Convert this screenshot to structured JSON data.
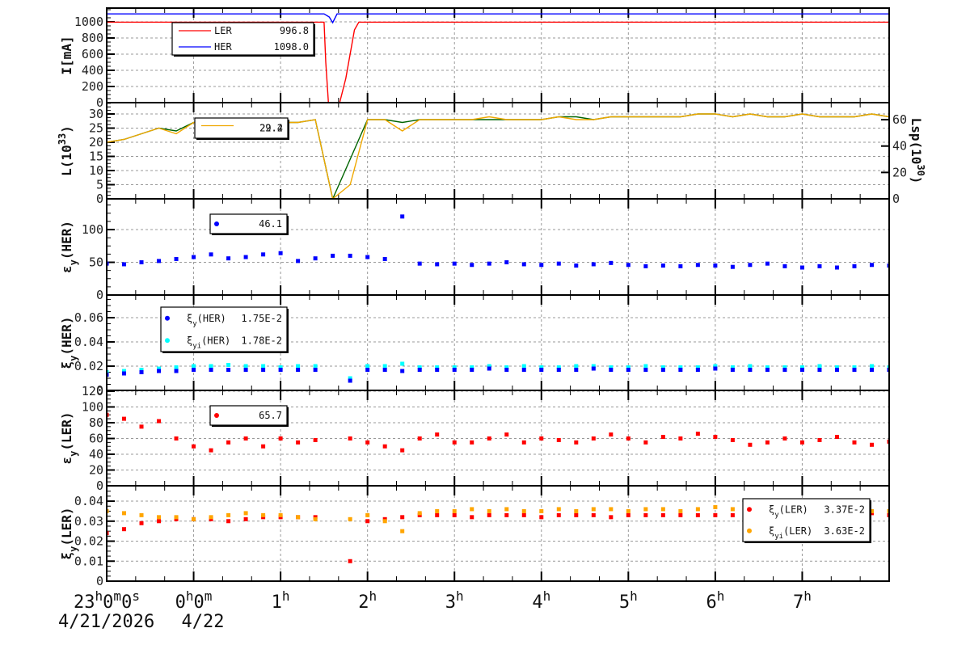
{
  "chart_data": {
    "type": "multi-panel time series",
    "x_axis": {
      "unit": "hours since 23:00 4/21/2026",
      "range": [
        0,
        9
      ],
      "tick_labels": [
        {
          "t": 0,
          "parts": [
            {
              "t": "23"
            },
            {
              "t": "h",
              "sup": true
            },
            {
              "t": "0"
            },
            {
              "t": "m",
              "sup": true
            },
            {
              "t": "0"
            },
            {
              "t": "s",
              "sup": true
            }
          ],
          "date": "4/21/2026"
        },
        {
          "t": 1,
          "parts": [
            {
              "t": "0"
            },
            {
              "t": "h",
              "sup": true
            },
            {
              "t": "0"
            },
            {
              "t": "m",
              "sup": true
            }
          ],
          "date": "4/22"
        },
        {
          "t": 2,
          "parts": [
            {
              "t": "1"
            },
            {
              "t": "h",
              "sup": true
            }
          ]
        },
        {
          "t": 3,
          "parts": [
            {
              "t": "2"
            },
            {
              "t": "h",
              "sup": true
            }
          ]
        },
        {
          "t": 4,
          "parts": [
            {
              "t": "3"
            },
            {
              "t": "h",
              "sup": true
            }
          ]
        },
        {
          "t": 5,
          "parts": [
            {
              "t": "4"
            },
            {
              "t": "h",
              "sup": true
            }
          ]
        },
        {
          "t": 6,
          "parts": [
            {
              "t": "5"
            },
            {
              "t": "h",
              "sup": true
            }
          ]
        },
        {
          "t": 7,
          "parts": [
            {
              "t": "6"
            },
            {
              "t": "h",
              "sup": true
            }
          ]
        },
        {
          "t": 8,
          "parts": [
            {
              "t": "7"
            },
            {
              "t": "h",
              "sup": true
            }
          ]
        }
      ]
    },
    "panels": [
      {
        "id": "current",
        "ylabel": [
          {
            "t": "I[mA]"
          }
        ],
        "ylim": [
          0,
          1170
        ],
        "yticks": [
          0,
          200,
          400,
          600,
          800,
          1000
        ],
        "series": [
          {
            "name": "LER",
            "kind": "line",
            "color": "#ff0000",
            "t": [
              0,
              2.5,
              2.52,
              2.55,
              2.68,
              2.75,
              2.85,
              2.9,
              9
            ],
            "values": [
              996,
              996,
              500,
              0,
              0,
              300,
              900,
              996,
              996
            ]
          },
          {
            "name": "HER",
            "kind": "line",
            "color": "#0000ff",
            "t": [
              0,
              2.5,
              2.56,
              2.6,
              2.65,
              9
            ],
            "values": [
              1098,
              1098,
              1060,
              990,
              1098,
              1098
            ]
          }
        ],
        "legend": [
          {
            "marker": "line",
            "color": "#ff0000",
            "label": "LER",
            "value": "996.8"
          },
          {
            "marker": "line",
            "color": "#0000ff",
            "label": "HER",
            "value": "1098.0"
          }
        ]
      },
      {
        "id": "luminosity",
        "ylabel": [
          {
            "t": "L(10"
          },
          {
            "t": "33",
            "sup": true
          },
          {
            "t": ")"
          }
        ],
        "ylim": [
          0,
          34
        ],
        "yticks": [
          0,
          5,
          10,
          15,
          20,
          25,
          30
        ],
        "y2label": [
          {
            "t": "Lsp(10"
          },
          {
            "t": "30",
            "sup": true
          },
          {
            "t": ")"
          }
        ],
        "y2lim": [
          0,
          72.9
        ],
        "y2ticks": [
          0,
          20,
          40,
          60
        ],
        "series": [
          {
            "name": "L HER",
            "kind": "line",
            "color": "#006400",
            "t_start": 0,
            "t_step": 0.2,
            "values": [
              20,
              21,
              23,
              25,
              24,
              27,
              27,
              27,
              27,
              26,
              27,
              27,
              28,
              0,
              14,
              28,
              28,
              27,
              28,
              28,
              28,
              28,
              28,
              28,
              28,
              28,
              29,
              29,
              28,
              29,
              29,
              29,
              29,
              29,
              30,
              30,
              29,
              30,
              29,
              29,
              30,
              29,
              29,
              29,
              30,
              29
            ]
          },
          {
            "name": "L LER",
            "kind": "line",
            "color": "#f0a800",
            "t_start": 0,
            "t_step": 0.2,
            "values": [
              20,
              21,
              23,
              25,
              23,
              27,
              26,
              27,
              27,
              25,
              27,
              27,
              28,
              0,
              5,
              28,
              28,
              24,
              28,
              28,
              28,
              28,
              29,
              28,
              28,
              28,
              29,
              28,
              28,
              29,
              29,
              29,
              29,
              29,
              30,
              30,
              29,
              30,
              29,
              29,
              30,
              29,
              29,
              29,
              30,
              29
            ]
          }
        ],
        "legend": [
          {
            "marker": "line",
            "color": "#f0a800",
            "label": "",
            "value": "29.4"
          },
          {
            "marker": "none",
            "color": "#006400",
            "label": "",
            "value": "22.2"
          }
        ]
      },
      {
        "id": "emittance-her",
        "ylabel": [
          {
            "t": "ε"
          },
          {
            "t": "y",
            "sub": true
          },
          {
            "t": "(HER)"
          }
        ],
        "ylim": [
          0,
          147
        ],
        "yticks": [
          0,
          50,
          100
        ],
        "series": [
          {
            "name": "εy(HER)",
            "kind": "scatter",
            "color": "#0000ff",
            "t_start": 0,
            "t_step": 0.2,
            "values": [
              48,
              47,
              50,
              52,
              55,
              58,
              62,
              56,
              58,
              62,
              64,
              52,
              56,
              60,
              60,
              58,
              55,
              120,
              48,
              47,
              48,
              46,
              48,
              50,
              47,
              46,
              48,
              45,
              47,
              49,
              46,
              44,
              45,
              44,
              46,
              45,
              43,
              46,
              48,
              44,
              42,
              44,
              42,
              44,
              46,
              45
            ]
          }
        ],
        "legend": [
          {
            "marker": "dot",
            "color": "#0000ff",
            "label": "",
            "value": "46.1"
          }
        ]
      },
      {
        "id": "xi-her",
        "ylabel": [
          {
            "t": "ξ"
          },
          {
            "t": "y",
            "sub": true
          },
          {
            "t": "(HER)"
          }
        ],
        "ylim": [
          0,
          0.0787
        ],
        "yticks": [
          0,
          0.02,
          0.04,
          0.06
        ],
        "ytick_labels": [
          "0",
          "0.02",
          "0.04",
          "0.06"
        ],
        "series": [
          {
            "name": "ξyi(HER)",
            "kind": "scatter",
            "color": "#00ffff",
            "t_start": 0,
            "t_step": 0.2,
            "values": [
              0.015,
              0.016,
              0.017,
              0.018,
              0.019,
              0.02,
              0.02,
              0.021,
              0.02,
              0.02,
              0.019,
              0.02,
              0.02,
              null,
              0.01,
              0.02,
              0.02,
              0.022,
              0.019,
              0.019,
              0.019,
              0.019,
              0.02,
              0.019,
              0.02,
              0.019,
              0.019,
              0.02,
              0.02,
              0.019,
              0.019,
              0.02,
              0.019,
              0.019,
              0.019,
              0.02,
              0.019,
              0.02,
              0.019,
              0.019,
              0.019,
              0.02,
              0.019,
              0.019,
              0.02,
              0.019
            ]
          },
          {
            "name": "ξy(HER)",
            "kind": "scatter",
            "color": "#0000ff",
            "t_start": 0,
            "t_step": 0.2,
            "values": [
              0.013,
              0.014,
              0.015,
              0.016,
              0.016,
              0.017,
              0.017,
              0.017,
              0.017,
              0.017,
              0.017,
              0.017,
              0.017,
              null,
              0.008,
              0.017,
              0.017,
              0.016,
              0.017,
              0.017,
              0.017,
              0.017,
              0.018,
              0.017,
              0.017,
              0.017,
              0.017,
              0.017,
              0.018,
              0.017,
              0.017,
              0.017,
              0.017,
              0.017,
              0.017,
              0.018,
              0.017,
              0.017,
              0.017,
              0.017,
              0.017,
              0.017,
              0.017,
              0.017,
              0.017,
              0.017
            ]
          }
        ],
        "legend": [
          {
            "marker": "dot",
            "color": "#0000ff",
            "label": [
              {
                "t": "ξ"
              },
              {
                "t": "y",
                "sub": true
              },
              {
                "t": "(HER)"
              }
            ],
            "value": "1.75E-2"
          },
          {
            "marker": "dot",
            "color": "#00ffff",
            "label": [
              {
                "t": "ξ"
              },
              {
                "t": "yi",
                "sub": true
              },
              {
                "t": "(HER)"
              }
            ],
            "value": "1.78E-2"
          }
        ]
      },
      {
        "id": "emittance-ler",
        "ylabel": [
          {
            "t": "ε"
          },
          {
            "t": "y",
            "sub": true
          },
          {
            "t": "(LER)"
          }
        ],
        "ylim": [
          0,
          121
        ],
        "yticks": [
          0,
          20,
          40,
          60,
          80,
          100,
          120
        ],
        "series": [
          {
            "name": "εy(LER)",
            "kind": "scatter",
            "color": "#ff0000",
            "t_start": 0,
            "t_step": 0.2,
            "values": [
              90,
              85,
              75,
              82,
              60,
              50,
              45,
              55,
              60,
              50,
              60,
              55,
              58,
              null,
              60,
              55,
              50,
              45,
              60,
              65,
              55,
              55,
              60,
              65,
              55,
              60,
              58,
              55,
              60,
              65,
              60,
              55,
              62,
              60,
              66,
              62,
              58,
              52,
              55,
              60,
              55,
              58,
              62,
              55,
              52,
              56
            ]
          }
        ],
        "legend": [
          {
            "marker": "dot",
            "color": "#ff0000",
            "label": "",
            "value": "65.7"
          }
        ]
      },
      {
        "id": "xi-ler",
        "ylabel": [
          {
            "t": "ξ"
          },
          {
            "t": "y",
            "sub": true
          },
          {
            "t": "(LER)"
          }
        ],
        "ylim": [
          0,
          0.0477
        ],
        "yticks": [
          0,
          0.01,
          0.02,
          0.03,
          0.04
        ],
        "ytick_labels": [
          "0",
          "0.01",
          "0.02",
          "0.03",
          "0.04"
        ],
        "series": [
          {
            "name": "ξy(LER)",
            "kind": "scatter",
            "color": "#ff0000",
            "t_start": 0,
            "t_step": 0.2,
            "values": [
              0.024,
              0.026,
              0.029,
              0.03,
              0.031,
              0.031,
              0.031,
              0.03,
              0.031,
              0.032,
              0.032,
              0.032,
              0.032,
              null,
              0.01,
              0.03,
              0.031,
              0.032,
              0.033,
              0.033,
              0.033,
              0.032,
              0.033,
              0.033,
              0.033,
              0.032,
              0.033,
              0.033,
              0.033,
              0.032,
              0.033,
              0.033,
              0.033,
              0.033,
              0.033,
              0.033,
              0.033,
              0.033,
              0.033,
              0.033,
              0.033,
              0.033,
              0.033,
              0.033,
              0.034,
              0.033
            ]
          },
          {
            "name": "ξyi(LER)",
            "kind": "scatter",
            "color": "#ffa500",
            "t_start": 0,
            "t_step": 0.2,
            "values": [
              0.035,
              0.034,
              0.033,
              0.032,
              0.032,
              0.031,
              0.032,
              0.033,
              0.034,
              0.033,
              0.033,
              0.032,
              0.031,
              null,
              0.031,
              0.033,
              0.03,
              0.025,
              0.034,
              0.035,
              0.035,
              0.036,
              0.035,
              0.036,
              0.035,
              0.035,
              0.036,
              0.035,
              0.036,
              0.036,
              0.035,
              0.036,
              0.036,
              0.035,
              0.036,
              0.037,
              0.036,
              0.036,
              0.037,
              0.036,
              0.036,
              0.035,
              0.036,
              0.036,
              0.035,
              0.035
            ]
          }
        ],
        "legend": [
          {
            "marker": "dot",
            "color": "#ff0000",
            "label": [
              {
                "t": "ξ"
              },
              {
                "t": "y",
                "sub": true
              },
              {
                "t": "(LER)"
              }
            ],
            "value": "3.37E-2"
          },
          {
            "marker": "dot",
            "color": "#ffa500",
            "label": [
              {
                "t": "ξ"
              },
              {
                "t": "yi",
                "sub": true
              },
              {
                "t": "(LER)"
              }
            ],
            "value": "3.63E-2"
          }
        ]
      }
    ]
  }
}
